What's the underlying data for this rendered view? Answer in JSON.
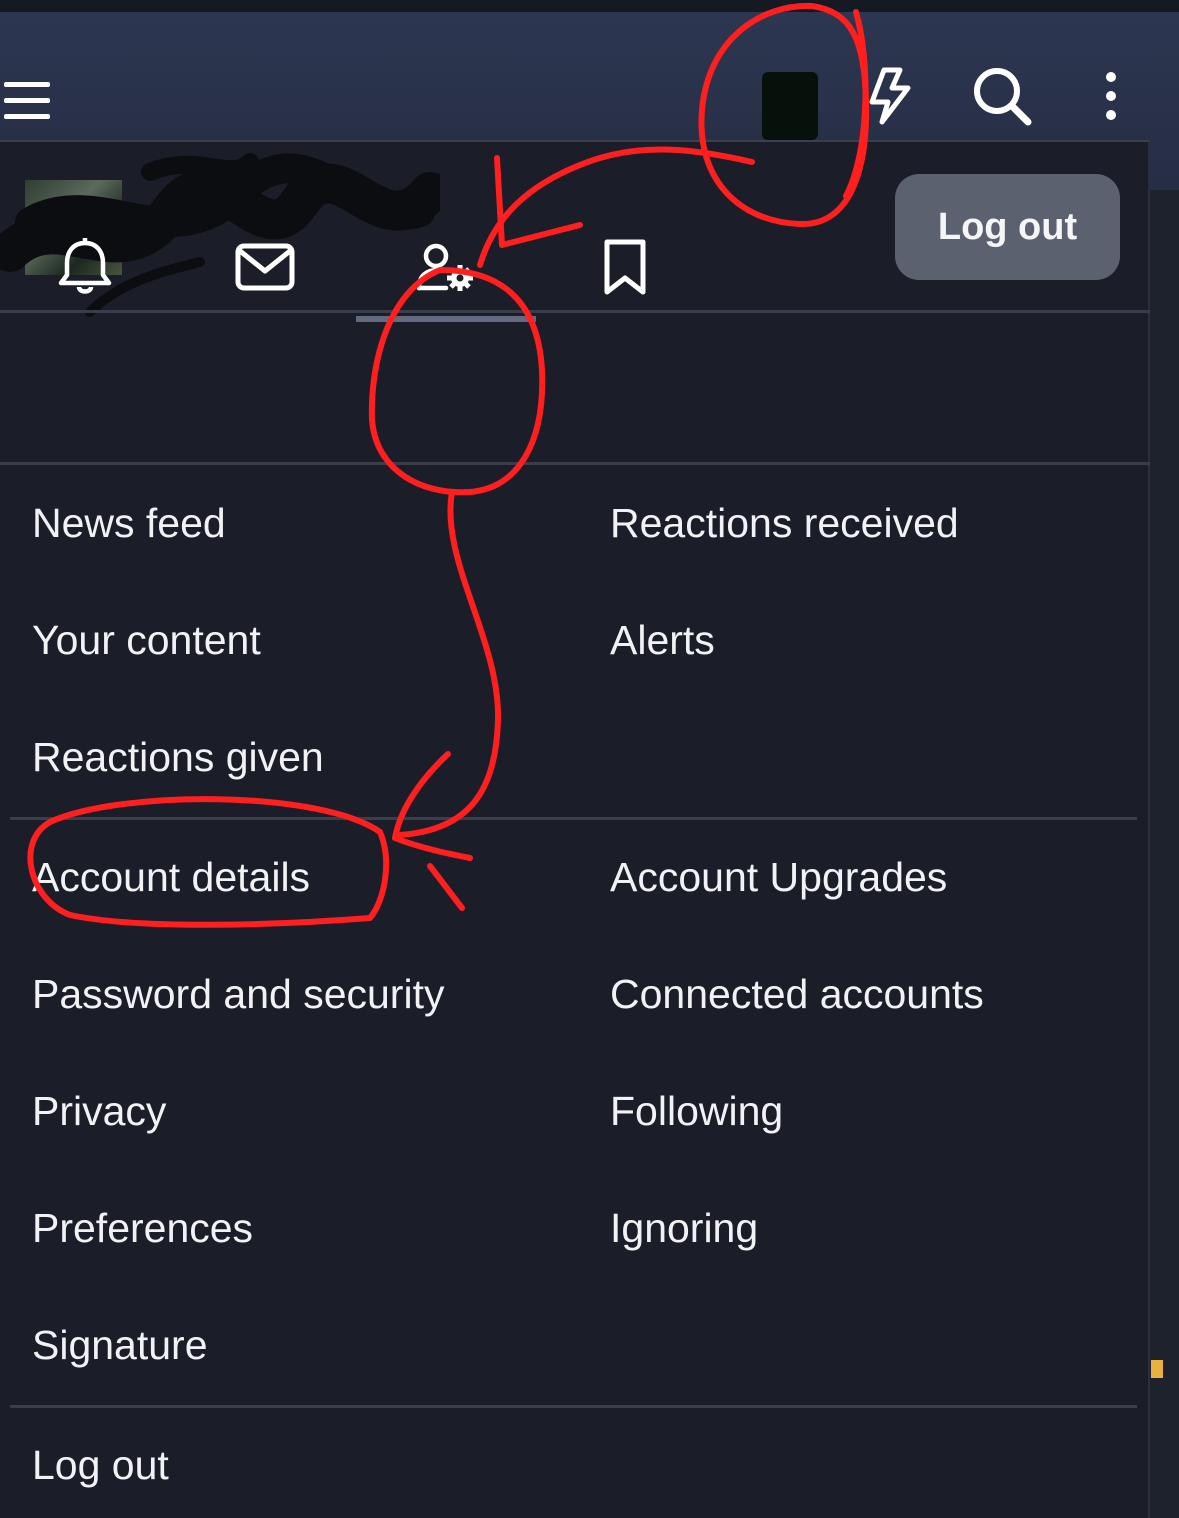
{
  "header": {
    "icons": [
      "menu-icon",
      "avatar",
      "bolt-icon",
      "search-icon",
      "more-vertical-icon"
    ]
  },
  "account_panel": {
    "logout_button_label": "Log out",
    "tabs": [
      {
        "name": "alerts",
        "icon": "bell-icon"
      },
      {
        "name": "conversations",
        "icon": "envelope-icon"
      },
      {
        "name": "account",
        "icon": "user-cog-icon",
        "active": true
      },
      {
        "name": "bookmarks",
        "icon": "bookmark-icon"
      }
    ],
    "section1": {
      "left": [
        "News feed",
        "Your content",
        "Reactions given"
      ],
      "right": [
        "Reactions received",
        "Alerts"
      ]
    },
    "section2": {
      "left": [
        "Account details",
        "Password and security",
        "Privacy",
        "Preferences",
        "Signature"
      ],
      "right": [
        "Account Upgrades",
        "Connected accounts",
        "Following",
        "Ignoring"
      ]
    },
    "footer_logout": "Log out"
  },
  "colors": {
    "appbar": "#2d3650",
    "panel": "#1b1e28",
    "text": "#f1f2f5",
    "logout_button": "#5c6170",
    "annotation": "#ff1f1f",
    "redaction": "#0b0d10"
  }
}
